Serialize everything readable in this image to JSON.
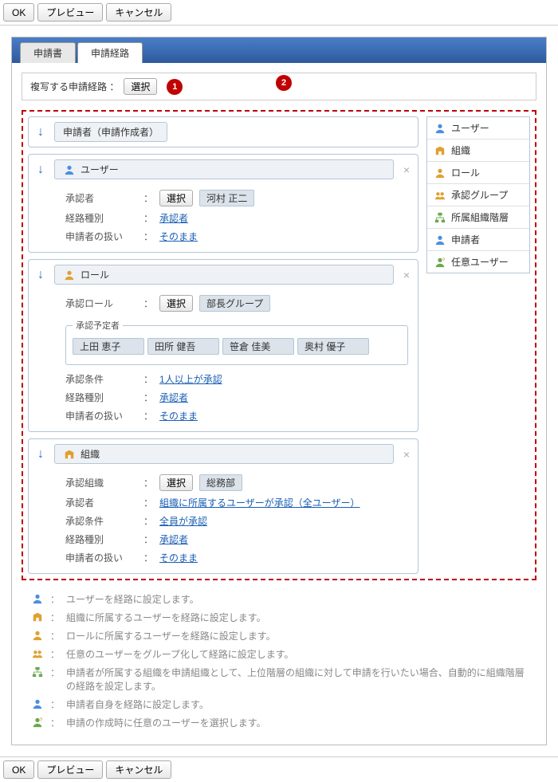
{
  "buttons": {
    "ok": "OK",
    "preview": "プレビュー",
    "cancel": "キャンセル",
    "select": "選択"
  },
  "tabs": {
    "form": "申請書",
    "route": "申請経路"
  },
  "copyRoute": {
    "label": "複写する申請経路 ："
  },
  "callouts": {
    "one": "1",
    "two": "2"
  },
  "blocks": {
    "applicant": {
      "title": "申請者（申請作成者）"
    },
    "user": {
      "title": "ユーザー",
      "fields": {
        "approver": {
          "label": "承認者",
          "tag": "河村 正二"
        },
        "routeType": {
          "label": "経路種別",
          "value": "承認者"
        },
        "handling": {
          "label": "申請者の扱い",
          "value": "そのまま"
        }
      }
    },
    "role": {
      "title": "ロール",
      "fields": {
        "approveRole": {
          "label": "承認ロール",
          "tag": "部長グループ"
        },
        "plannedApprovers": {
          "legend": "承認予定者",
          "names": [
            "上田 恵子",
            "田所 健吾",
            "笹倉 佳美",
            "奥村 優子"
          ]
        },
        "condition": {
          "label": "承認条件",
          "value": "1人以上が承認"
        },
        "routeType": {
          "label": "経路種別",
          "value": "承認者"
        },
        "handling": {
          "label": "申請者の扱い",
          "value": "そのまま"
        }
      }
    },
    "org": {
      "title": "組織",
      "fields": {
        "approveOrg": {
          "label": "承認組織",
          "tag": "総務部"
        },
        "approver": {
          "label": "承認者",
          "value": "組織に所属するユーザーが承認（全ユーザー）"
        },
        "condition": {
          "label": "承認条件",
          "value": "全員が承認"
        },
        "routeType": {
          "label": "経路種別",
          "value": "承認者"
        },
        "handling": {
          "label": "申請者の扱い",
          "value": "そのまま"
        }
      }
    }
  },
  "sidebar": {
    "items": [
      {
        "icon": "user-icon",
        "label": "ユーザー"
      },
      {
        "icon": "org-icon",
        "label": "組織"
      },
      {
        "icon": "role-icon",
        "label": "ロール"
      },
      {
        "icon": "group-icon",
        "label": "承認グループ"
      },
      {
        "icon": "hier-icon",
        "label": "所属組織階層"
      },
      {
        "icon": "applicant-icon",
        "label": "申請者"
      },
      {
        "icon": "anyuser-icon",
        "label": "任意ユーザー"
      }
    ]
  },
  "legend": [
    {
      "icon": "user-icon",
      "text": "ユーザーを経路に設定します。"
    },
    {
      "icon": "org-icon",
      "text": "組織に所属するユーザーを経路に設定します。"
    },
    {
      "icon": "role-icon",
      "text": "ロールに所属するユーザーを経路に設定します。"
    },
    {
      "icon": "group-icon",
      "text": "任意のユーザーをグループ化して経路に設定します。"
    },
    {
      "icon": "hier-icon",
      "text": "申請者が所属する組織を申請組織として、上位階層の組織に対して申請を行いたい場合、自動的に組織階層の経路を設定します。"
    },
    {
      "icon": "applicant-icon",
      "text": "申請者自身を経路に設定します。"
    },
    {
      "icon": "anyuser-icon",
      "text": "申請の作成時に任意のユーザーを選択します。"
    }
  ],
  "iconColors": {
    "user-icon": "#4b8fe0",
    "org-icon": "#e0a030",
    "role-icon": "#e0a030",
    "group-icon": "#e0a030",
    "hier-icon": "#6aa84f",
    "applicant-icon": "#4b8fe0",
    "anyuser-icon": "#6aa84f"
  }
}
